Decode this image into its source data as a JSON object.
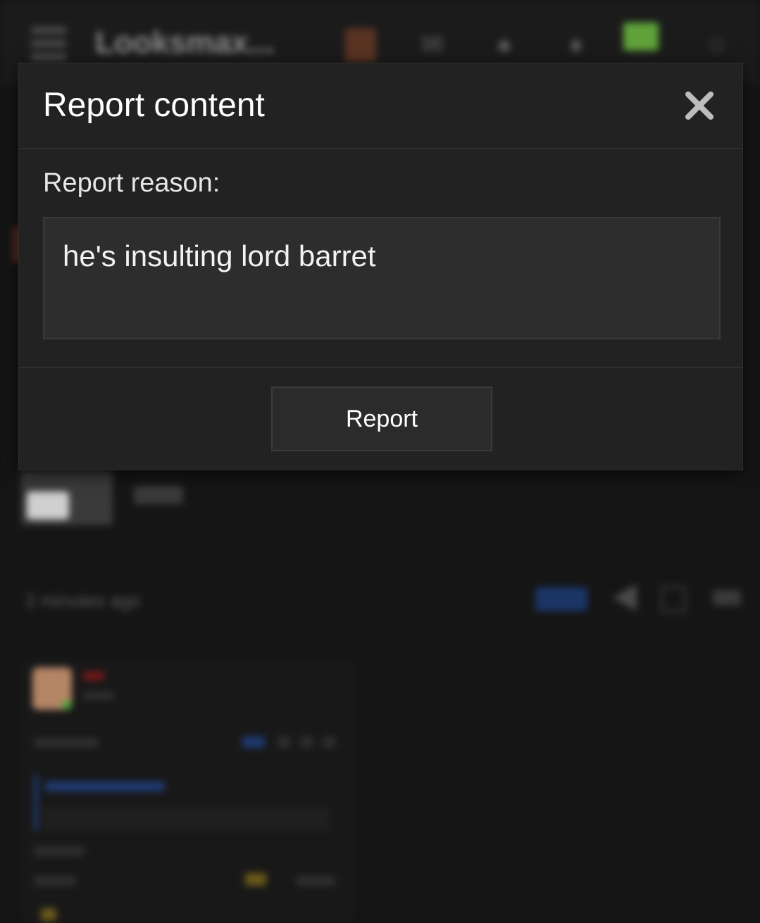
{
  "background_page": {
    "logo_text": "Looksmax...",
    "post_time": "2 minutes ago",
    "new_badge": "New",
    "post_number": "#1"
  },
  "modal": {
    "title": "Report content",
    "close_icon": "close-icon",
    "reason_label": "Report reason:",
    "reason_value": "he's insulting lord barret",
    "report_button_label": "Report"
  },
  "colors": {
    "page_background": "#141414",
    "modal_background": "#222222",
    "input_background": "#2d2d2d",
    "button_background": "#2b2b2b",
    "text_primary": "#ffffff"
  }
}
